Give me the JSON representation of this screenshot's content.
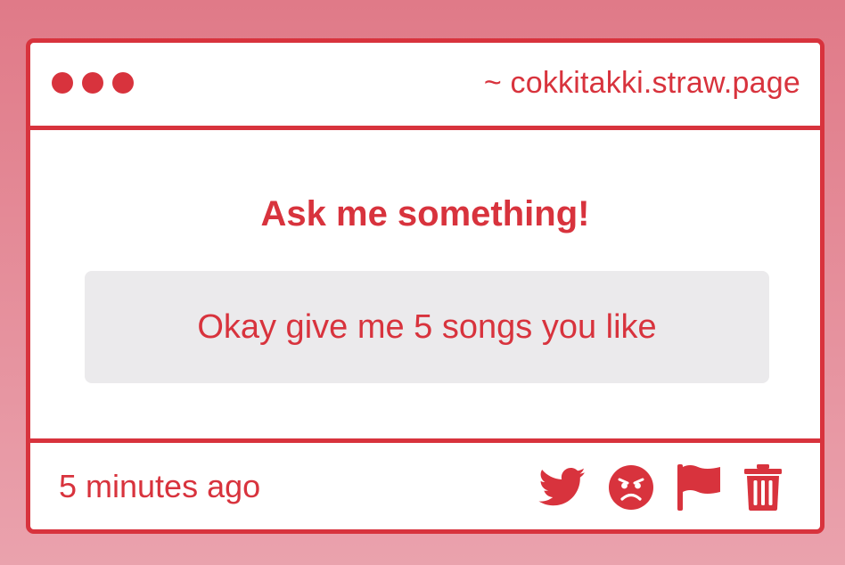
{
  "window": {
    "url": "~ cokkitakki.straw.page"
  },
  "main": {
    "prompt": "Ask me something!",
    "question": "Okay give me 5 songs you like"
  },
  "footer": {
    "timestamp": "5 minutes ago",
    "actions": [
      {
        "icon": "twitter-icon"
      },
      {
        "icon": "angry-face-icon"
      },
      {
        "icon": "flag-icon"
      },
      {
        "icon": "trash-icon"
      }
    ]
  },
  "colors": {
    "accent": "#d8333d",
    "background_top": "#e07a88",
    "background_bottom": "#eaa2ad",
    "question_bg": "#ebeaec"
  }
}
